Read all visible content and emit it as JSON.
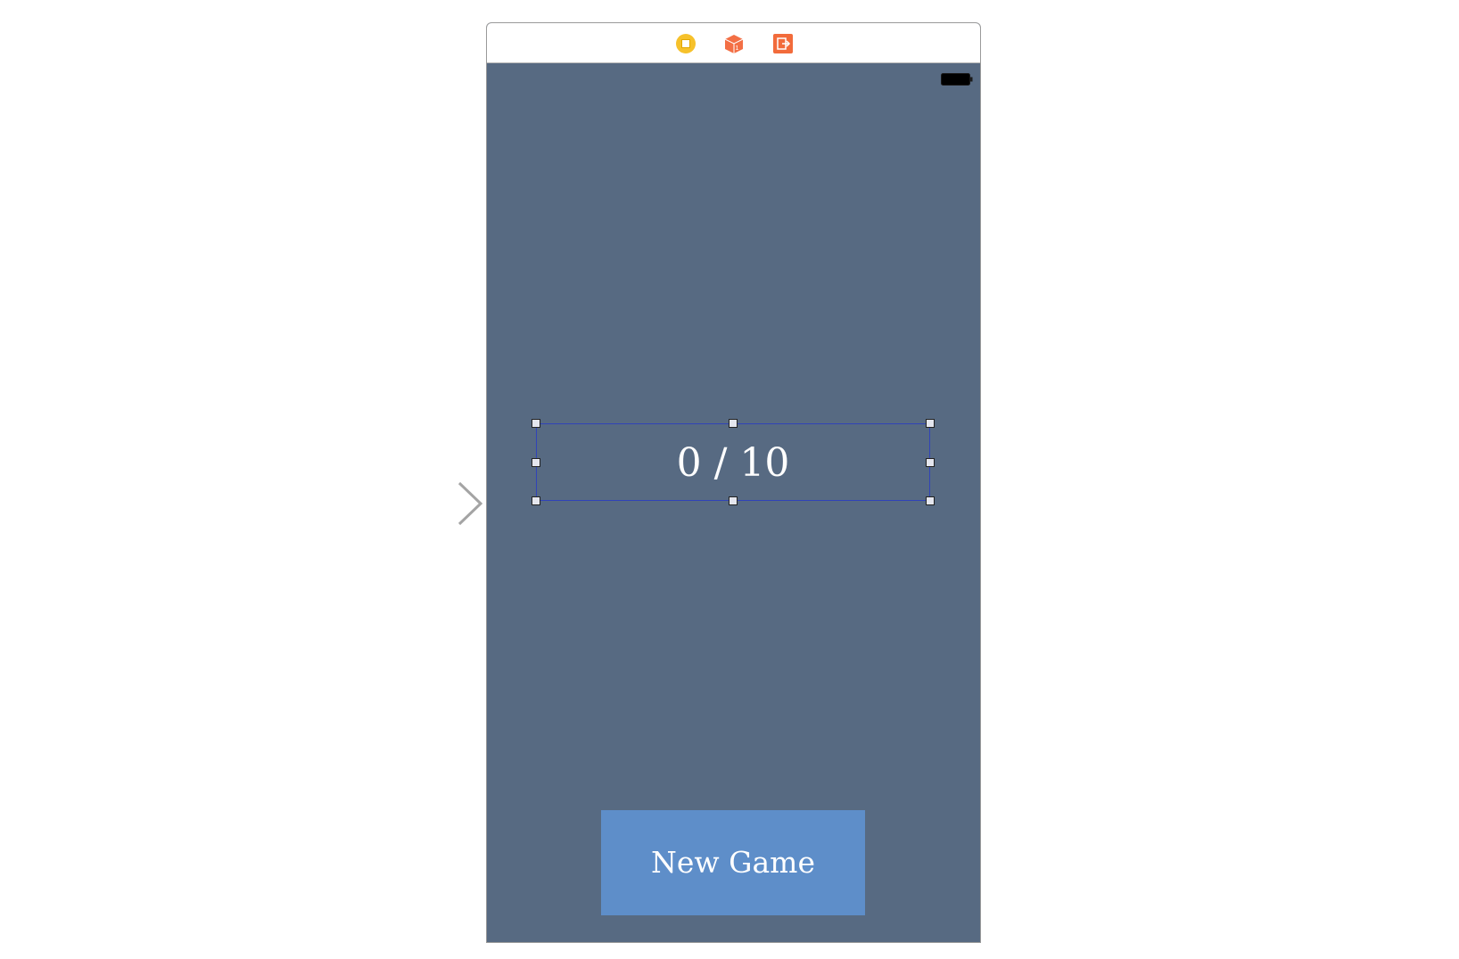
{
  "storyboard": {
    "scene": {
      "background_color": "#576a82",
      "dock": {
        "icons": [
          "view-controller-icon",
          "first-responder-icon",
          "exit-icon"
        ]
      },
      "status_bar": {
        "battery_icon": "battery-icon"
      },
      "score_label": {
        "text": "0 / 10",
        "selected": true
      },
      "new_game_button": {
        "label": "New Game",
        "color": "#5e8ec9"
      }
    },
    "entry_point": "initial-view-controller-arrow-icon",
    "colors": {
      "selection": "#3043b8",
      "vc_icon": "#f6c12b",
      "first_responder": "#f36f45",
      "exit": "#f26b3b"
    }
  }
}
